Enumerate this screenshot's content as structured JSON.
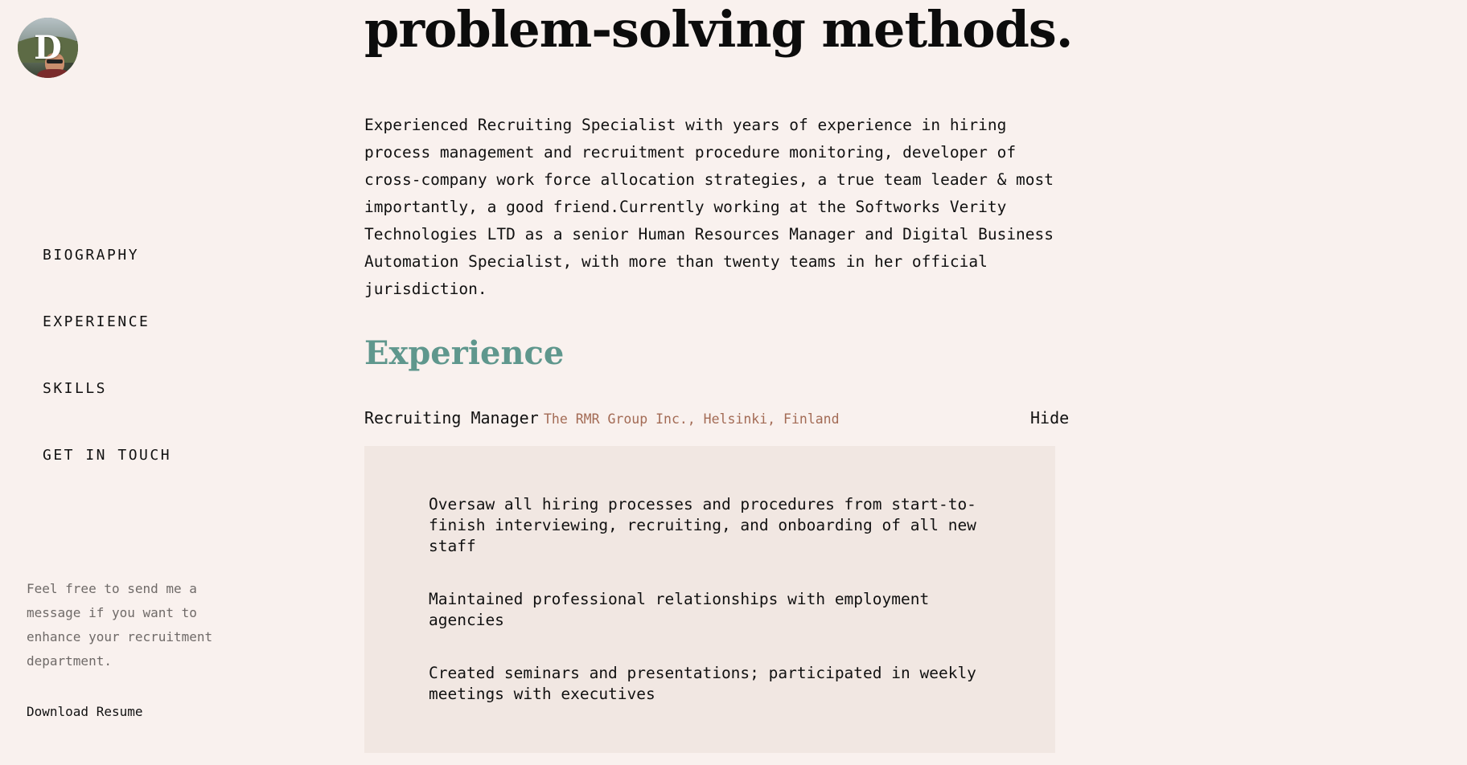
{
  "sidebar": {
    "avatar_initial": "D",
    "nav": [
      {
        "label": "BIOGRAPHY"
      },
      {
        "label": "EXPERIENCE"
      },
      {
        "label": "SKILLS"
      },
      {
        "label": "GET IN TOUCH"
      }
    ],
    "note": "Feel free to send me a message if you want to enhance your recruitment department.",
    "download_label": "Download Resume"
  },
  "main": {
    "headline": "problem-solving methods.",
    "bio": "Experienced Recruiting Specialist with years of experience in hiring process management and recruitment procedure monitoring, developer of cross-company work force allocation strategies, a true team leader & most importantly, a good friend.Currently working at the Softworks Verity Technologies LTD as a senior Human Resources Manager and Digital Business Automation Specialist, with more than twenty teams in her official jurisdiction.",
    "experience_title": "Experience",
    "jobs": [
      {
        "title": "Recruiting Manager",
        "company": "The RMR Group Inc., Helsinki, Finland",
        "toggle_label": "Hide",
        "duties": [
          "Oversaw all hiring processes and procedures from start-to-finish interviewing, recruiting, and onboarding of all new staff",
          "Maintained professional relationships with employment agencies",
          "Created seminars and presentations; participated in weekly meetings with executives"
        ]
      }
    ]
  },
  "colors": {
    "background": "#f9f1ee",
    "panel": "#f1e7e2",
    "accent_teal": "#5f978d",
    "accent_rust": "#a36b55",
    "muted_text": "#6f6a68"
  }
}
